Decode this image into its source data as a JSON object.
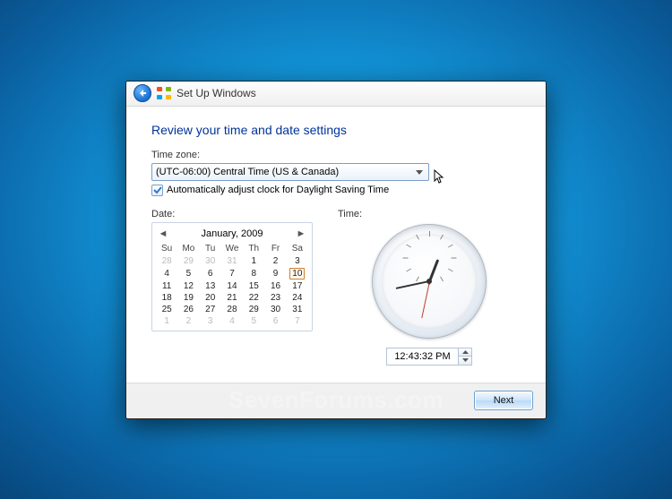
{
  "watermark": "SevenForums.com",
  "titlebar": {
    "title": "Set Up Windows"
  },
  "heading": "Review your time and date settings",
  "timezone": {
    "label": "Time zone:",
    "selected": "(UTC-06:00) Central Time (US & Canada)"
  },
  "dst": {
    "checked": true,
    "label": "Automatically adjust clock for Daylight Saving Time"
  },
  "date": {
    "label": "Date:",
    "month_title": "January, 2009",
    "day_headers": [
      "Su",
      "Mo",
      "Tu",
      "We",
      "Th",
      "Fr",
      "Sa"
    ],
    "today": 10,
    "weeks": [
      [
        {
          "d": 28,
          "dim": true
        },
        {
          "d": 29,
          "dim": true
        },
        {
          "d": 30,
          "dim": true
        },
        {
          "d": 31,
          "dim": true
        },
        {
          "d": 1
        },
        {
          "d": 2
        },
        {
          "d": 3
        }
      ],
      [
        {
          "d": 4
        },
        {
          "d": 5
        },
        {
          "d": 6
        },
        {
          "d": 7
        },
        {
          "d": 8
        },
        {
          "d": 9
        },
        {
          "d": 10
        }
      ],
      [
        {
          "d": 11
        },
        {
          "d": 12
        },
        {
          "d": 13
        },
        {
          "d": 14
        },
        {
          "d": 15
        },
        {
          "d": 16
        },
        {
          "d": 17
        }
      ],
      [
        {
          "d": 18
        },
        {
          "d": 19
        },
        {
          "d": 20
        },
        {
          "d": 21
        },
        {
          "d": 22
        },
        {
          "d": 23
        },
        {
          "d": 24
        }
      ],
      [
        {
          "d": 25
        },
        {
          "d": 26
        },
        {
          "d": 27
        },
        {
          "d": 28
        },
        {
          "d": 29
        },
        {
          "d": 30
        },
        {
          "d": 31
        }
      ],
      [
        {
          "d": 1,
          "dim": true
        },
        {
          "d": 2,
          "dim": true
        },
        {
          "d": 3,
          "dim": true
        },
        {
          "d": 4,
          "dim": true
        },
        {
          "d": 5,
          "dim": true
        },
        {
          "d": 6,
          "dim": true
        },
        {
          "d": 7,
          "dim": true
        }
      ]
    ]
  },
  "time": {
    "label": "Time:",
    "value": "12:43:32 PM"
  },
  "footer": {
    "next": "Next"
  }
}
